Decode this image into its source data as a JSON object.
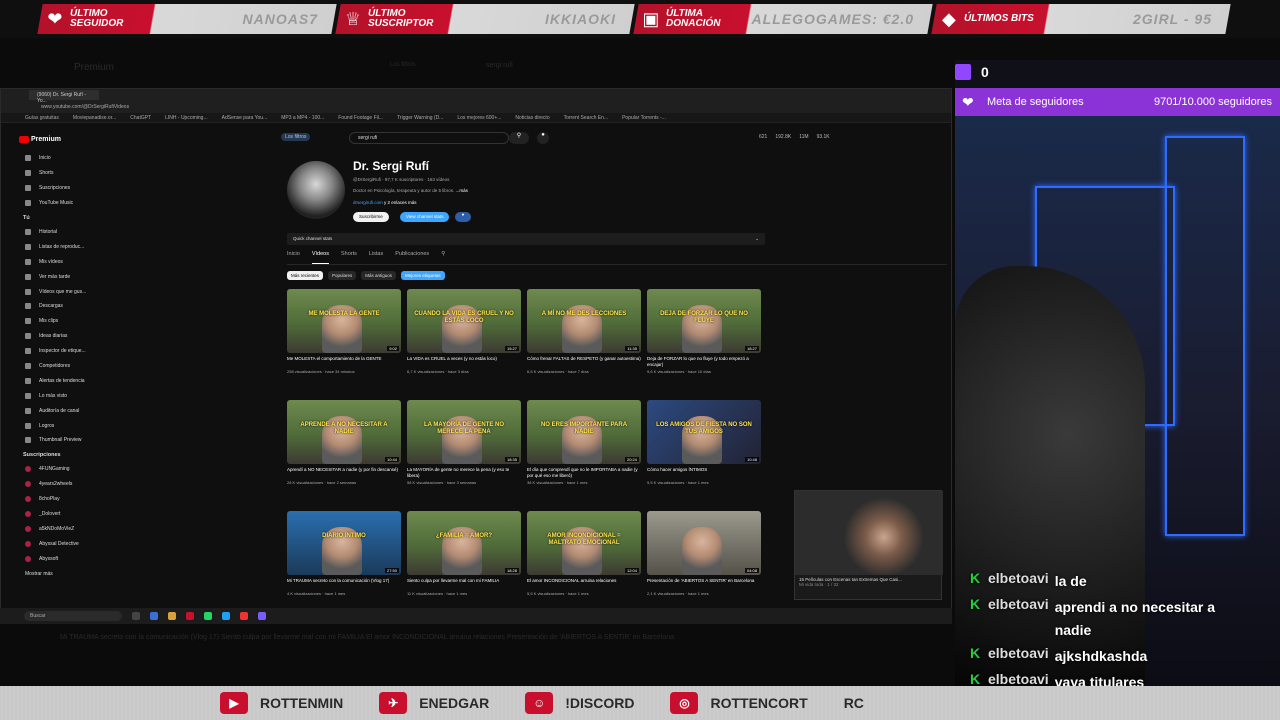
{
  "top_banner": {
    "items": [
      {
        "label": "ÚLTIMO SEGUIDOR",
        "value": "NANOAS7",
        "icon": "heart-icon"
      },
      {
        "label": "ÚLTIMO SUSCRIPTOR",
        "value": "IKKIAOKI",
        "icon": "trophy-icon"
      },
      {
        "label": "ÚLTIMA DONACIÓN",
        "value": "ALLEGOGAMES: €2.0",
        "icon": "gift-icon"
      },
      {
        "label": "ÚLTIMOS BITS",
        "value": "2GIRL - 95",
        "icon": "gem-icon"
      }
    ],
    "accent": "#c8102e"
  },
  "bg_desktop": {
    "premium_label": "Premium",
    "filters": "Los filtros",
    "query": "sergi rufi"
  },
  "browser": {
    "tab_title": "(9060) Dr. Sergi Rufí - Yo...",
    "url": "www.youtube.com/@DrSergiRufiVideos",
    "bookmarks": [
      "Guías gratuitas",
      "Moviepanadise.or...",
      "ChatGPT",
      "LINH - Upcoming...",
      "AdSense para You...",
      "MP3 a MP4 - 100...",
      "Found Footage Fil...",
      "Trigger Warning (D...",
      "Los mejores 600+...",
      "Noticias directo",
      "Torrent Search En...",
      "Popular Torrents -..."
    ]
  },
  "yt": {
    "logo": "Premium",
    "filters_chip": "Los filtros",
    "search_value": "sergi rufi",
    "header_stats": [
      "621",
      "192.8K",
      "11M",
      "93.1K"
    ],
    "sidebar": {
      "items": [
        "Inicio",
        "Shorts",
        "Suscripciones",
        "YouTube Music"
      ],
      "you_header": "Tú",
      "you_items": [
        "Historial",
        "Listas de reproduc...",
        "Mis vídeos",
        "Ver más tarde",
        "Vídeos que me gus...",
        "Descargas",
        "Mis clips",
        "Ideas diarias",
        "Inspector de etique...",
        "Competidores",
        "Alertas de tendencia",
        "Lo más visto",
        "Auditoría de canal",
        "Logros",
        "Thumbnail Preview"
      ],
      "subs_header": "Suscripciones",
      "subs": [
        "4FUNGaming",
        "4years2wheels",
        "8choPlay",
        "_Dolovert",
        "a5kNDoMoVieZ",
        "Abyssal Detective",
        "Abyssoft"
      ],
      "show_more": "Mostrar más"
    },
    "channel": {
      "name": "Dr. Sergi Rufí",
      "handle": "@DrSergiRufi",
      "subscribers": "97,7 K suscriptores",
      "videos_count": "163 vídeos",
      "description": "Doctor en Psicología, terapeuta y autor de 5 libros.",
      "more": "...más",
      "link": "drsergirufi.com",
      "links_more": "y 2 enlaces más",
      "subscribe_btn": "Suscribirme",
      "stats_btn": "View channel stats",
      "quick_stats": "Quick channel stats",
      "tabs": [
        "Inicio",
        "Vídeos",
        "Shorts",
        "Listas",
        "Publicaciones"
      ],
      "sort_chips": [
        "Más recientes",
        "Populares",
        "Más antiguos",
        "Mejores etiquetas"
      ]
    },
    "videos": [
      {
        "caption": "ME MOLESTA LA GENTE",
        "title": "Me MOLESTA el comportamiento de la GENTE",
        "meta": "258 visualizaciones · hace 34 minutos",
        "dur": "9:02"
      },
      {
        "caption": "CUANDO LA VIDA ES CRUEL Y NO ESTÁS LOCO",
        "title": "La VIDA es CRUEL a veces (y no estás loco)",
        "meta": "6,7 K visualizaciones · hace 3 días",
        "dur": "15:27"
      },
      {
        "caption": "A MÍ NO ME DES LECCIONES",
        "title": "Cómo frenar FALTAS de RESPETO (y ganar autoestima)",
        "meta": "6,5 K visualizaciones · hace 7 días",
        "dur": "11:35"
      },
      {
        "caption": "DEJA DE FORZAR LO QUE NO FLUYE",
        "title": "Deja de FORZAR lo que no fluye (y todo empezó a encajar)",
        "meta": "9,6 K visualizaciones · hace 10 días",
        "dur": "18:27"
      },
      {
        "caption": "APRENDE A NO NECESITAR A NADIE",
        "title": "Aprendí a NO NECESITAR a nadie (y por fin descansé)",
        "meta": "28 K visualizaciones · hace 2 semanas",
        "dur": "10:44"
      },
      {
        "caption": "LA MAYORÍA DE GENTE NO MERECE LA PENA",
        "title": "La MAYORÍA de gente no merece la pena (y eso te libera)",
        "meta": "58 K visualizaciones · hace 3 semanas",
        "dur": "18:35"
      },
      {
        "caption": "NO ERES IMPORTANTE PARA NADIE",
        "title": "El día que comprendí que no le IMPORTABA a nadie (y por qué eso me liberó)",
        "meta": "38 K visualizaciones · hace 1 mes",
        "dur": "20:24"
      },
      {
        "caption": "LOS AMIGOS DE FIESTA NO SON TUS AMIGOS",
        "title": "Cómo hacer amigos ÍNTIMOS",
        "meta": "9,5 K visualizaciones · hace 1 mes",
        "dur": "10:48"
      },
      {
        "caption": "DIARIO ÍNTIMO",
        "title": "Mi TRAUMA secreto con la comunicación (Vlog 17)",
        "meta": "4 K visualizaciones · hace 1 mes",
        "dur": "27:50"
      },
      {
        "caption": "¿FAMILIA = AMOR?",
        "title": "Siento culpa por llevarme mal con mi FAMILIA",
        "meta": "11 K visualizaciones · hace 1 mes",
        "dur": "18:28"
      },
      {
        "caption": "AMOR INCONDICIONAL = MALTRATO EMOCIONAL",
        "title": "El amor INCONDICIONAL arruina relaciones",
        "meta": "5,5 K visualizaciones · hace 1 mes",
        "dur": "12:04"
      },
      {
        "caption": "",
        "title": "Presentación de 'ABIERTOS A SENTIR' en Barcelona",
        "meta": "2,1 K visualizaciones · hace 1 mes",
        "dur": "04:08"
      }
    ]
  },
  "taskbar": {
    "search_placeholder": "Buscar"
  },
  "cam_inset": {
    "title": "15 Películas con Escenas tan Extremas Que Casi...",
    "sub": "Mi vida toda · 1 / 32"
  },
  "stream": {
    "twitch_count": "0",
    "follower_goal_label": "Meta de seguidores",
    "follower_goal_value": "9701/10.000 seguidores",
    "goal_color": "#8b33d6"
  },
  "chat": [
    {
      "user": "elbetoavi",
      "msg": "la de"
    },
    {
      "user": "elbetoavi",
      "msg": "aprendi a no necesitar a nadie"
    },
    {
      "user": "elbetoavi",
      "msg": "ajkshdkashda"
    },
    {
      "user": "elbetoavi",
      "msg": "vaya titulares"
    }
  ],
  "bottom_banner": {
    "items": [
      {
        "icon": "youtube-icon",
        "label": "ROTTENMIN"
      },
      {
        "icon": "twitter-icon",
        "label": "ENEDGAR"
      },
      {
        "icon": "discord-icon",
        "label": "!DISCORD"
      },
      {
        "icon": "instagram-icon",
        "label": "ROTTENCORT"
      }
    ],
    "tail": "RC"
  },
  "bg_text": "Mi TRAUMA secreto con la comunicación (Vlog 17)   Siento culpa por llevarme mal con mi FAMILIA   El amor INCONDICIONAL arruina relaciones   Presentación de 'ABIERTOS A SENTIR' en Barcelona"
}
